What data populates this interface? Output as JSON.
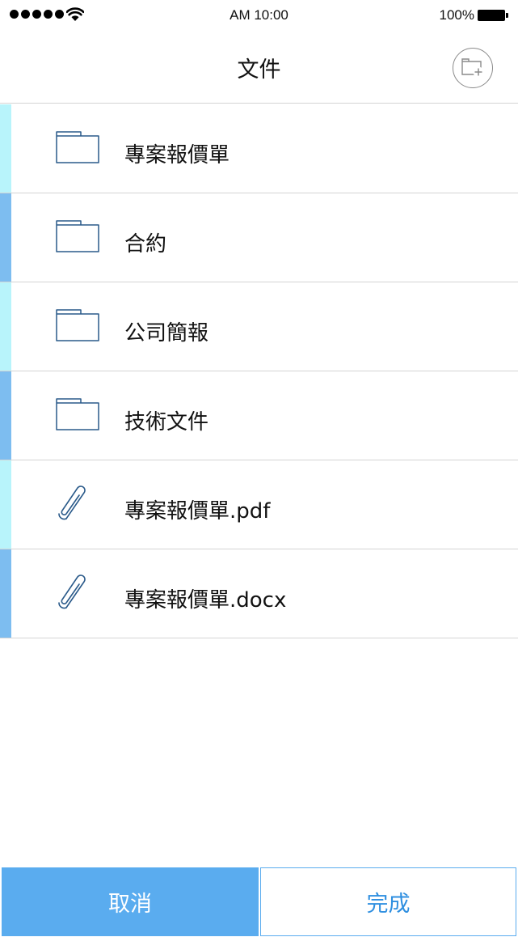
{
  "status_bar": {
    "time": "AM 10:00",
    "battery": "100%",
    "signal_bars": 5,
    "icons": [
      "signal-dots-icon",
      "wifi-icon",
      "battery-icon"
    ]
  },
  "header": {
    "title": "文件",
    "new_folder_icon": "folder-add-icon"
  },
  "items": [
    {
      "label": "專案報價單",
      "type": "folder",
      "icon": "folder-icon",
      "accent": "#b8f4fb"
    },
    {
      "label": "合約",
      "type": "folder",
      "icon": "folder-icon",
      "accent": "#7dbdf0"
    },
    {
      "label": "公司簡報",
      "type": "folder",
      "icon": "folder-icon",
      "accent": "#b8f4fb"
    },
    {
      "label": "技術文件",
      "type": "folder",
      "icon": "folder-icon",
      "accent": "#7dbdf0"
    },
    {
      "label": "專案報價單.pdf",
      "type": "file",
      "icon": "paperclip-icon",
      "accent": "#b8f4fb"
    },
    {
      "label": "專案報價單.docx",
      "type": "file",
      "icon": "paperclip-icon",
      "accent": "#7dbdf0"
    }
  ],
  "footer": {
    "cancel_label": "取消",
    "done_label": "完成"
  },
  "colors": {
    "accent_light": "#b8f4fb",
    "accent_dark": "#7dbdf0",
    "primary_button": "#5aacef",
    "done_text": "#2f8fe0",
    "icon_stroke": "#2a5a8a"
  }
}
